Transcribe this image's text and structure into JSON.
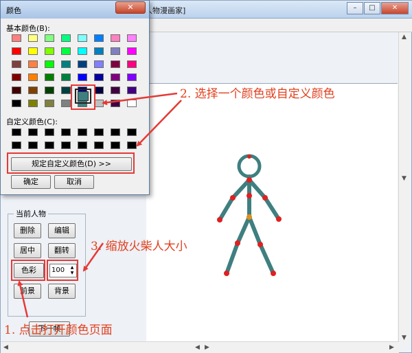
{
  "app": {
    "title": "人物漫画家]",
    "window_buttons": {
      "minimize": "–",
      "maximize": "□",
      "close": "✕"
    }
  },
  "dialog": {
    "title": "颜色",
    "close_glyph": "✕",
    "basic_label": "基本颜色(B):",
    "custom_label": "自定义颜色(C):",
    "define_button": "规定自定义颜色(D) >>",
    "ok_button": "确定",
    "cancel_button": "取消",
    "basic_colors": [
      "#ff8080",
      "#ffff80",
      "#80ff80",
      "#00ff80",
      "#80ffff",
      "#0080ff",
      "#ff80c0",
      "#ff80ff",
      "#ff0000",
      "#ffff00",
      "#80ff00",
      "#00ff40",
      "#00ffff",
      "#0080c0",
      "#8080c0",
      "#ff00ff",
      "#804040",
      "#ff8040",
      "#00ff00",
      "#008080",
      "#004080",
      "#8080ff",
      "#800040",
      "#ff0080",
      "#800000",
      "#ff8000",
      "#008000",
      "#008040",
      "#0000ff",
      "#0000a0",
      "#800080",
      "#8000ff",
      "#400000",
      "#804000",
      "#004000",
      "#004040",
      "#000080",
      "#000040",
      "#400040",
      "#400080",
      "#000000",
      "#808000",
      "#808040",
      "#808080",
      "#408080",
      "#c0c0c0",
      "#400040",
      "#ffffff"
    ],
    "custom_colors": [
      "#000000",
      "#000000",
      "#000000",
      "#000000",
      "#000000",
      "#000000",
      "#000000",
      "#000000",
      "#000000",
      "#000000",
      "#000000",
      "#000000",
      "#000000",
      "#000000",
      "#000000",
      "#000000"
    ],
    "selected_color": "#3f7f80"
  },
  "panel": {
    "legend": "当前人物",
    "buttons": {
      "delete": "删除",
      "edit": "编辑",
      "center": "居中",
      "flip": "翻转",
      "color": "色彩",
      "foreground": "前景",
      "background": "背景",
      "next_frame": "下一帧"
    },
    "scale_value": "100",
    "spin_up": "▲",
    "spin_down": "▼"
  },
  "scrollbar": {
    "up": "▲",
    "down": "▼",
    "left": "◀",
    "right": "▶"
  },
  "annotations": {
    "step1": "1. 点击打开颜色页面",
    "step2": "2. 选择一个颜色或自定义颜色",
    "step3": "3. 缩放火柴人大小"
  },
  "colors": {
    "annotation_red": "#e53935",
    "stickman_body": "#3f7f80",
    "stickman_joint": "#e02020",
    "stickman_hip": "#e0901a"
  }
}
